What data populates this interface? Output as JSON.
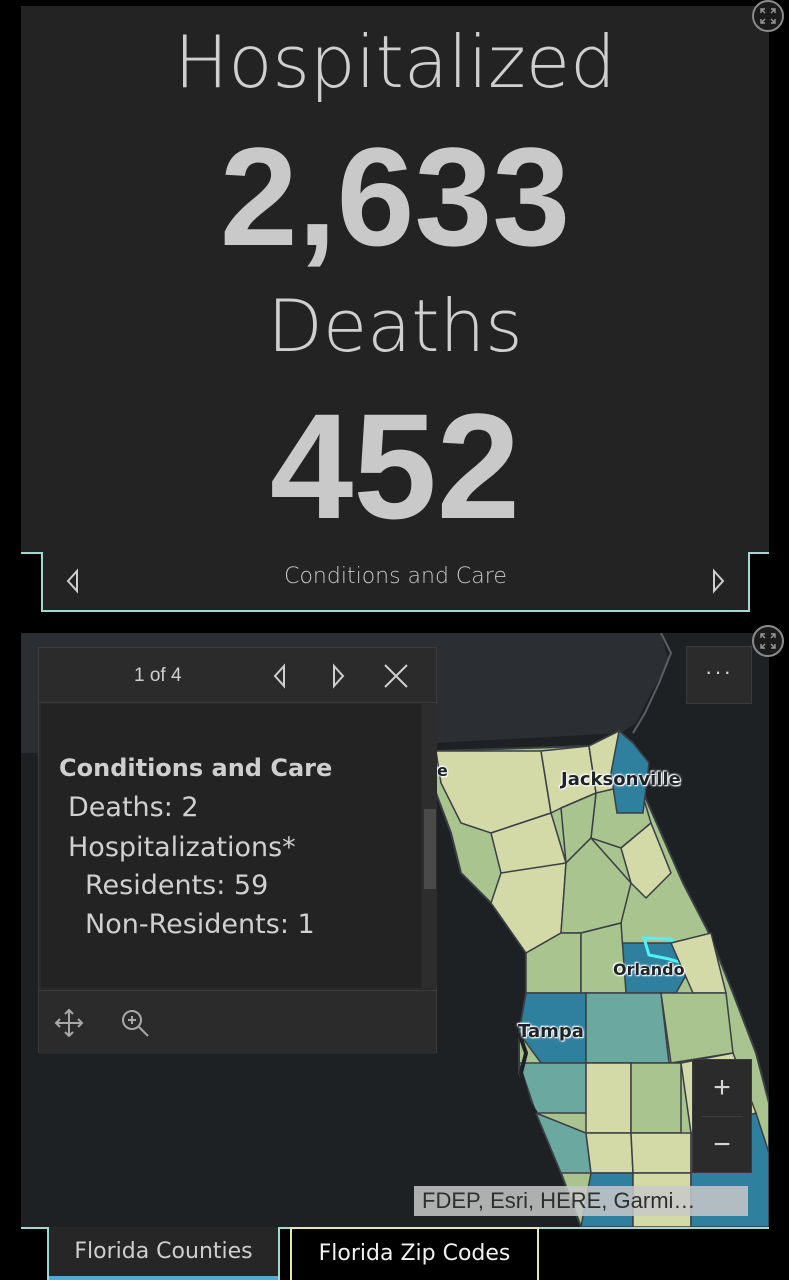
{
  "stats": {
    "hospitalized_label": "Hospitalized",
    "hospitalized_value": "2,633",
    "deaths_label": "Deaths",
    "deaths_value": "452"
  },
  "stats_tabs": {
    "title": "Conditions and Care",
    "prev_icon": "triangle-left-icon",
    "next_icon": "triangle-right-icon"
  },
  "map": {
    "city_labels": [
      "Jacksonville",
      "Orlando",
      "Tampa"
    ],
    "partial_label": "e",
    "more_label": "···",
    "zoom_in": "+",
    "zoom_out": "−",
    "attribution": "FDEP, Esri, HERE, Garmi…",
    "colors": {
      "water": "#1d2124",
      "land_dark": "#2b2f33",
      "county_light": "#d4d9a8",
      "county_green": "#a9c48f",
      "county_teal": "#6aa8a0",
      "county_blue": "#2f7f9e",
      "selected_outline": "#4ff3f5"
    }
  },
  "popup": {
    "count": "1 of 4",
    "heading": "Conditions and Care",
    "lines": [
      "Deaths: 2",
      "Hospitalizations*",
      "Residents: 59",
      "Non-Residents: 1"
    ],
    "icons": [
      "prev-icon",
      "next-icon",
      "close-icon",
      "pan-icon",
      "zoom-to-icon"
    ]
  },
  "bottom_tabs": {
    "counties": "Florida Counties",
    "zip": "Florida Zip Codes"
  },
  "colors": {
    "accent": "#9fd9d2",
    "panel_bg": "#232323",
    "tab_underline": "#53a9d0",
    "zip_tab_border": "#e8e8a8"
  }
}
